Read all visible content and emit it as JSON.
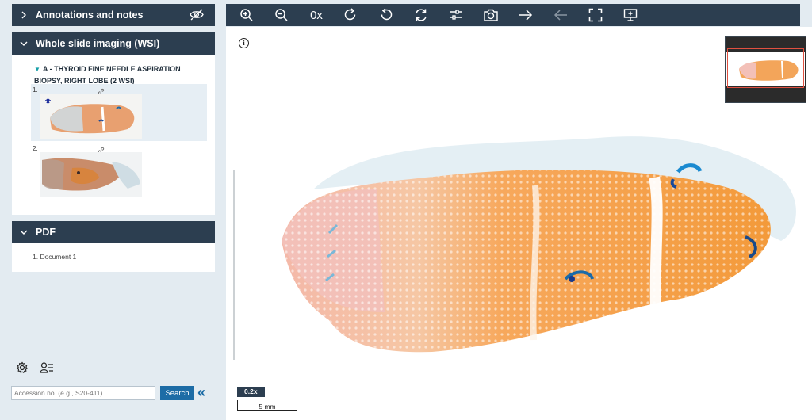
{
  "sections": {
    "annotations": {
      "title": "Annotations and notes"
    },
    "wsi": {
      "title": "Whole slide imaging (WSI)",
      "case_title": "A - THYROID FINE NEEDLE ASPIRATION BIOPSY, RIGHT LOBE (2 WSI)",
      "slides": [
        {
          "number": "1."
        },
        {
          "number": "2."
        }
      ]
    },
    "pdf": {
      "title": "PDF",
      "documents": [
        "1.  Document 1"
      ]
    }
  },
  "search": {
    "placeholder": "Accession no. (e.g., S20-411)",
    "button_label": "Search"
  },
  "toolbar": {
    "icons": [
      "zoom-in-icon",
      "zoom-out-icon",
      "reset-zoom-icon",
      "rotate-right-icon",
      "rotate-left-icon",
      "sync-icon",
      "adjust-icon",
      "camera-icon",
      "next-arrow-icon",
      "prev-arrow-icon",
      "fullscreen-icon",
      "presentation-icon"
    ],
    "reset_zoom_label": "0x"
  },
  "viewer": {
    "zoom_level": "0.2x",
    "scale_label": "5 mm"
  },
  "colors": {
    "header": "#2c3e50",
    "accent": "#1d6ca6",
    "tissue": "#f39a3a",
    "stain": "#1a6aa8"
  }
}
